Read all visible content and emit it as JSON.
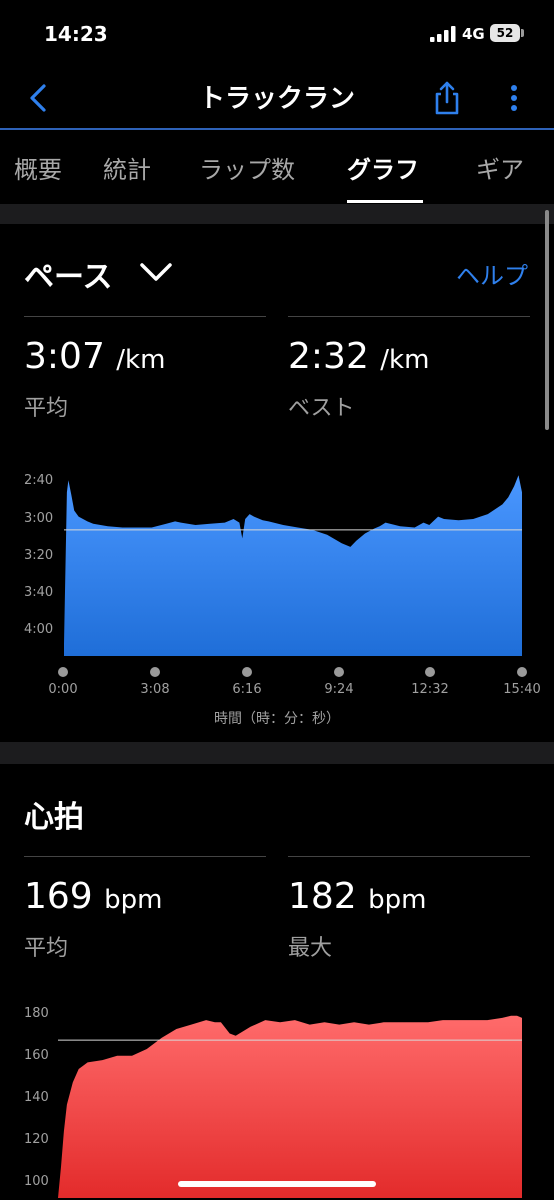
{
  "status_bar": {
    "time": "14:23",
    "network": "4G",
    "battery": "52"
  },
  "nav": {
    "title": "トラックラン"
  },
  "tabs": [
    {
      "label": "概要"
    },
    {
      "label": "統計"
    },
    {
      "label": "ラップ数"
    },
    {
      "label": "グラフ",
      "active": true
    },
    {
      "label": "ギア"
    }
  ],
  "pace": {
    "title": "ペース",
    "help": "ヘルプ",
    "avg_value": "3:07",
    "avg_unit": "/km",
    "avg_label": "平均",
    "best_value": "2:32",
    "best_unit": "/km",
    "best_label": "ベスト",
    "x_axis_label": "時間（時：分：秒）"
  },
  "heart": {
    "title": "心拍",
    "avg_value": "169",
    "avg_unit": "bpm",
    "avg_label": "平均",
    "max_value": "182",
    "max_unit": "bpm",
    "max_label": "最大"
  },
  "colors": {
    "accent": "#2f80ed",
    "pace_fill": "#2f7fe6",
    "hr_fill": "#ef3b3b",
    "nav_line": "#2e62b8"
  },
  "chart_data": [
    {
      "type": "area",
      "y_tick_labels": [
        "2:40",
        "3:00",
        "3:20",
        "3:40",
        "4:00"
      ],
      "x_tick_labels": [
        "0:00",
        "3:08",
        "6:16",
        "9:24",
        "12:32",
        "15:40"
      ],
      "xlabel": "時間（時：分：秒）",
      "y_inverted": true,
      "y_unit": "min/km",
      "ylim": [
        2.55,
        4.15
      ],
      "xlim": [
        0,
        15.67
      ],
      "avg_line": 3.11,
      "series": [
        {
          "x": [
            0,
            0.1,
            0.15,
            0.25,
            0.35,
            0.5,
            0.8,
            1.0,
            1.5,
            2.0,
            2.5,
            3.0,
            3.5,
            3.8,
            4.0,
            4.5,
            5.0,
            5.5,
            5.8,
            6.0,
            6.1,
            6.2,
            6.35,
            6.5,
            6.8,
            7.0,
            7.5,
            8.0,
            8.5,
            9.0,
            9.5,
            9.8,
            10.0,
            10.3,
            10.6,
            10.8,
            11.0,
            11.5,
            12.0,
            12.3,
            12.5,
            12.8,
            13.0,
            13.5,
            14.0,
            14.5,
            15.0,
            15.2,
            15.4,
            15.55,
            15.67
          ],
          "y": [
            4.05,
            2.8,
            2.7,
            2.82,
            2.95,
            3.0,
            3.04,
            3.06,
            3.08,
            3.09,
            3.09,
            3.09,
            3.06,
            3.04,
            3.05,
            3.07,
            3.06,
            3.05,
            3.02,
            3.05,
            3.18,
            3.02,
            2.98,
            3.0,
            3.03,
            3.04,
            3.07,
            3.09,
            3.11,
            3.15,
            3.22,
            3.25,
            3.2,
            3.14,
            3.1,
            3.08,
            3.05,
            3.08,
            3.09,
            3.05,
            3.07,
            3.0,
            3.02,
            3.03,
            3.02,
            2.98,
            2.9,
            2.84,
            2.75,
            2.66,
            2.8
          ]
        }
      ]
    },
    {
      "type": "area",
      "y_ticks": [
        180,
        160,
        140,
        120,
        100
      ],
      "ylim": [
        98,
        183
      ],
      "xlim": [
        0,
        15.67
      ],
      "avg_line": 169,
      "series": [
        {
          "x": [
            0,
            0.1,
            0.2,
            0.3,
            0.5,
            0.7,
            0.9,
            1.0,
            1.5,
            2.0,
            2.5,
            3.0,
            3.5,
            4.0,
            4.5,
            5.0,
            5.3,
            5.5,
            5.8,
            6.0,
            6.5,
            7.0,
            7.5,
            8.0,
            8.5,
            9.0,
            9.5,
            10.0,
            10.5,
            11.0,
            11.5,
            12.0,
            12.5,
            13.0,
            13.5,
            14.0,
            14.5,
            15.0,
            15.3,
            15.5,
            15.67
          ],
          "y": [
            98,
            112,
            128,
            140,
            150,
            156,
            158,
            159,
            160,
            162,
            162,
            165,
            170,
            174,
            176,
            178,
            177,
            177,
            172,
            171,
            175,
            178,
            177,
            178,
            176,
            177,
            176,
            177,
            176,
            177,
            177,
            177,
            177,
            178,
            178,
            178,
            178,
            179,
            180,
            180,
            179
          ]
        }
      ]
    }
  ]
}
